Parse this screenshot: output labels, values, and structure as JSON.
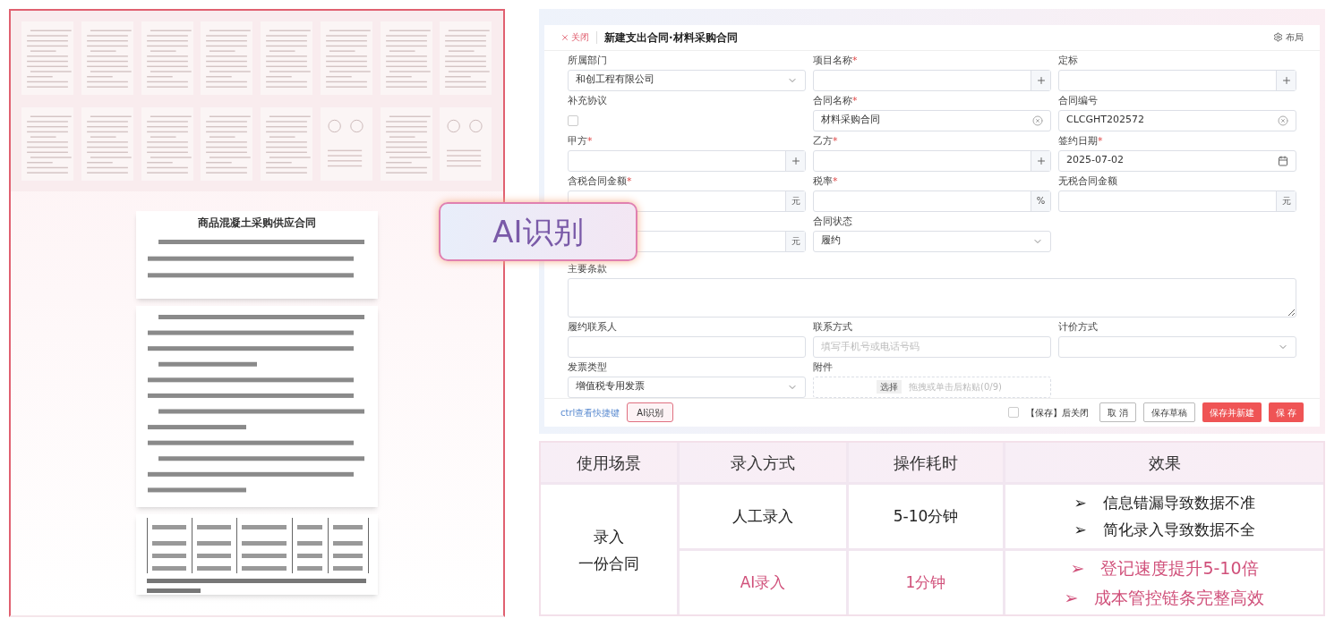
{
  "source": {
    "thumbnails": [
      {
        "kind": "text"
      },
      {
        "kind": "text"
      },
      {
        "kind": "text"
      },
      {
        "kind": "text"
      },
      {
        "kind": "text"
      },
      {
        "kind": "text"
      },
      {
        "kind": "text"
      },
      {
        "kind": "text"
      },
      {
        "kind": "text"
      },
      {
        "kind": "text"
      },
      {
        "kind": "text"
      },
      {
        "kind": "text"
      },
      {
        "kind": "text"
      },
      {
        "kind": "diagram"
      },
      {
        "kind": "text"
      },
      {
        "kind": "diagram"
      }
    ],
    "document": {
      "title": "商品混凝土采购供应合同"
    }
  },
  "badge": "AI识别",
  "form": {
    "close": "关闭",
    "title": "新建支出合同·材料采购合同",
    "layout": "布局",
    "fields": [
      {
        "label": "所属部门",
        "kind": "select",
        "value": "和创工程有限公司"
      },
      {
        "label": "项目名称",
        "required": "*",
        "kind": "add"
      },
      {
        "label": "定标",
        "kind": "add"
      },
      {
        "label": "补充协议",
        "kind": "checkbox",
        "checked": false
      },
      {
        "label": "合同名称",
        "required": "*",
        "kind": "clear",
        "value": "材料采购合同"
      },
      {
        "label": "合同编号",
        "kind": "clear",
        "value": "CLCGHT202572"
      },
      {
        "label": "甲方",
        "required": "*",
        "kind": "add"
      },
      {
        "label": "乙方",
        "required": "*",
        "kind": "add"
      },
      {
        "label": "签约日期",
        "required": "*",
        "kind": "date",
        "value": "2025-07-02"
      },
      {
        "label": "含税合同金额",
        "required": "*",
        "kind": "unit",
        "unit": "元"
      },
      {
        "label": "税率",
        "required": "*",
        "kind": "unit",
        "unit": "%"
      },
      {
        "label": "无税合同金额",
        "kind": "unit",
        "unit": "元"
      },
      {
        "kind": "unit",
        "unit": "元"
      },
      {
        "label": "合同状态",
        "kind": "select",
        "value": "履约"
      },
      {
        "kind": "empty"
      },
      {
        "label": "主要条款",
        "kind": "textarea"
      },
      {
        "label": "履约联系人",
        "kind": "text"
      },
      {
        "label": "联系方式",
        "kind": "text",
        "placeholder": "填写手机号或电话号码"
      },
      {
        "label": "计价方式",
        "kind": "select"
      },
      {
        "label": "发票类型",
        "kind": "select",
        "value": "增值税专用发票"
      },
      {
        "label": "附件",
        "kind": "upload",
        "button": "选择",
        "placeholder": "拖拽或单击后粘贴(0/9)"
      },
      {
        "kind": "empty"
      }
    ],
    "shortcut_link": "ctrl查看快捷键",
    "ai_button": "AI识别",
    "close_after_save": {
      "label": "【保存】后关闭",
      "checked": false
    },
    "buttons": [
      {
        "label": "取 消",
        "primary": false
      },
      {
        "label": "保存草稿",
        "primary": false
      },
      {
        "label": "保存并新建",
        "primary": true
      },
      {
        "label": "保 存",
        "primary": true
      }
    ]
  },
  "comparison": {
    "columns": [
      "使用场景",
      "录入方式",
      "操作耗时",
      "效果"
    ],
    "scenario": [
      "录入",
      "一份合同"
    ],
    "rows": [
      {
        "method": "人工录入",
        "time": "5-10分钟",
        "highlight": false,
        "effects": [
          {
            "marker": "➢",
            "text": "信息错漏导致数据不准"
          },
          {
            "marker": "➢",
            "text": "简化录入导致数据不全"
          }
        ]
      },
      {
        "method": "AI录入",
        "time": "1分钟",
        "highlight": true,
        "effects": [
          {
            "marker": "➢",
            "text": "登记速度提升5-10倍"
          },
          {
            "marker": "➢",
            "text": "成本管控链条完整高效"
          }
        ]
      }
    ]
  }
}
